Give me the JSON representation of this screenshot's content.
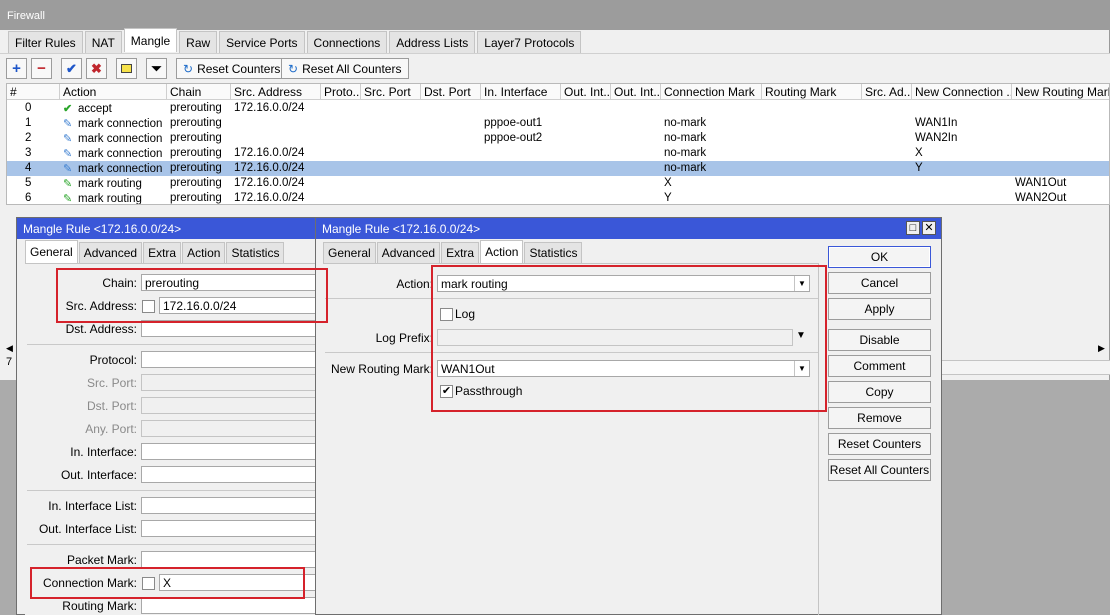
{
  "firewall": {
    "title": "Firewall",
    "tabs": [
      "Filter Rules",
      "NAT",
      "Mangle",
      "Raw",
      "Service Ports",
      "Connections",
      "Address Lists",
      "Layer7 Protocols"
    ],
    "active_tab": "Mangle",
    "toolbar": {
      "reset_counters": "Reset Counters",
      "reset_all_counters": "Reset All Counters"
    },
    "columns": [
      "#",
      "Action",
      "Chain",
      "Src. Address",
      "Proto...",
      "Src. Port",
      "Dst. Port",
      "In. Interface",
      "Out. Int...",
      "Out. Int...",
      "Connection Mark",
      "Routing Mark",
      "Src. Ad...",
      "New Connection ...",
      "New Routing Mark"
    ],
    "rows": [
      {
        "num": "0",
        "action": "accept",
        "icon": "check-icon",
        "chain": "prerouting",
        "src": "172.16.0.0/24",
        "in_if": "",
        "conn_mark": "",
        "new_conn": "",
        "new_route": ""
      },
      {
        "num": "1",
        "action": "mark connection",
        "icon": "pencil-blue-icon",
        "chain": "prerouting",
        "src": "",
        "in_if": "pppoe-out1",
        "conn_mark": "no-mark",
        "new_conn": "WAN1In",
        "new_route": ""
      },
      {
        "num": "2",
        "action": "mark connection",
        "icon": "pencil-blue-icon",
        "chain": "prerouting",
        "src": "",
        "in_if": "pppoe-out2",
        "conn_mark": "no-mark",
        "new_conn": "WAN2In",
        "new_route": ""
      },
      {
        "num": "3",
        "action": "mark connection",
        "icon": "pencil-blue-icon",
        "chain": "prerouting",
        "src": "172.16.0.0/24",
        "in_if": "",
        "conn_mark": "no-mark",
        "new_conn": "X",
        "new_route": ""
      },
      {
        "num": "4",
        "action": "mark connection",
        "icon": "pencil-blue-icon",
        "chain": "prerouting",
        "src": "172.16.0.0/24",
        "in_if": "",
        "conn_mark": "no-mark",
        "new_conn": "Y",
        "new_route": "",
        "selected": true
      },
      {
        "num": "5",
        "action": "mark routing",
        "icon": "pencil-green-icon",
        "chain": "prerouting",
        "src": "172.16.0.0/24",
        "in_if": "",
        "conn_mark": "X",
        "new_conn": "",
        "new_route": "WAN1Out"
      },
      {
        "num": "6",
        "action": "mark routing",
        "icon": "pencil-green-icon",
        "chain": "prerouting",
        "src": "172.16.0.0/24",
        "in_if": "",
        "conn_mark": "Y",
        "new_conn": "",
        "new_route": "WAN2Out"
      }
    ],
    "status_count": "7"
  },
  "dialog_left": {
    "title": "Mangle Rule <172.16.0.0/24>",
    "tabs": [
      "General",
      "Advanced",
      "Extra",
      "Action",
      "Statistics"
    ],
    "active_tab": "General",
    "chain_label": "Chain:",
    "chain_value": "prerouting",
    "src_address_label": "Src. Address:",
    "src_address_value": "172.16.0.0/24",
    "dst_address_label": "Dst. Address:",
    "protocol_label": "Protocol:",
    "src_port_label": "Src. Port:",
    "dst_port_label": "Dst. Port:",
    "any_port_label": "Any. Port:",
    "in_interface_label": "In. Interface:",
    "out_interface_label": "Out. Interface:",
    "in_interface_list_label": "In. Interface List:",
    "out_interface_list_label": "Out. Interface List:",
    "packet_mark_label": "Packet Mark:",
    "connection_mark_label": "Connection Mark:",
    "connection_mark_value": "X",
    "routing_mark_label": "Routing Mark:"
  },
  "dialog_right": {
    "title": "Mangle Rule <172.16.0.0/24>",
    "tabs": [
      "General",
      "Advanced",
      "Extra",
      "Action",
      "Statistics"
    ],
    "active_tab": "Action",
    "action_label": "Action:",
    "action_value": "mark routing",
    "log_label": "Log",
    "log_checked": false,
    "log_prefix_label": "Log Prefix:",
    "new_routing_mark_label": "New Routing Mark:",
    "new_routing_mark_value": "WAN1Out",
    "passthrough_label": "Passthrough",
    "passthrough_checked": true,
    "buttons": {
      "ok": "OK",
      "cancel": "Cancel",
      "apply": "Apply",
      "disable": "Disable",
      "comment": "Comment",
      "copy": "Copy",
      "remove": "Remove",
      "reset_counters": "Reset Counters",
      "reset_all_counters": "Reset All Counters"
    }
  },
  "accent_color": "#3a57d8",
  "highlight_color": "#d5222b"
}
